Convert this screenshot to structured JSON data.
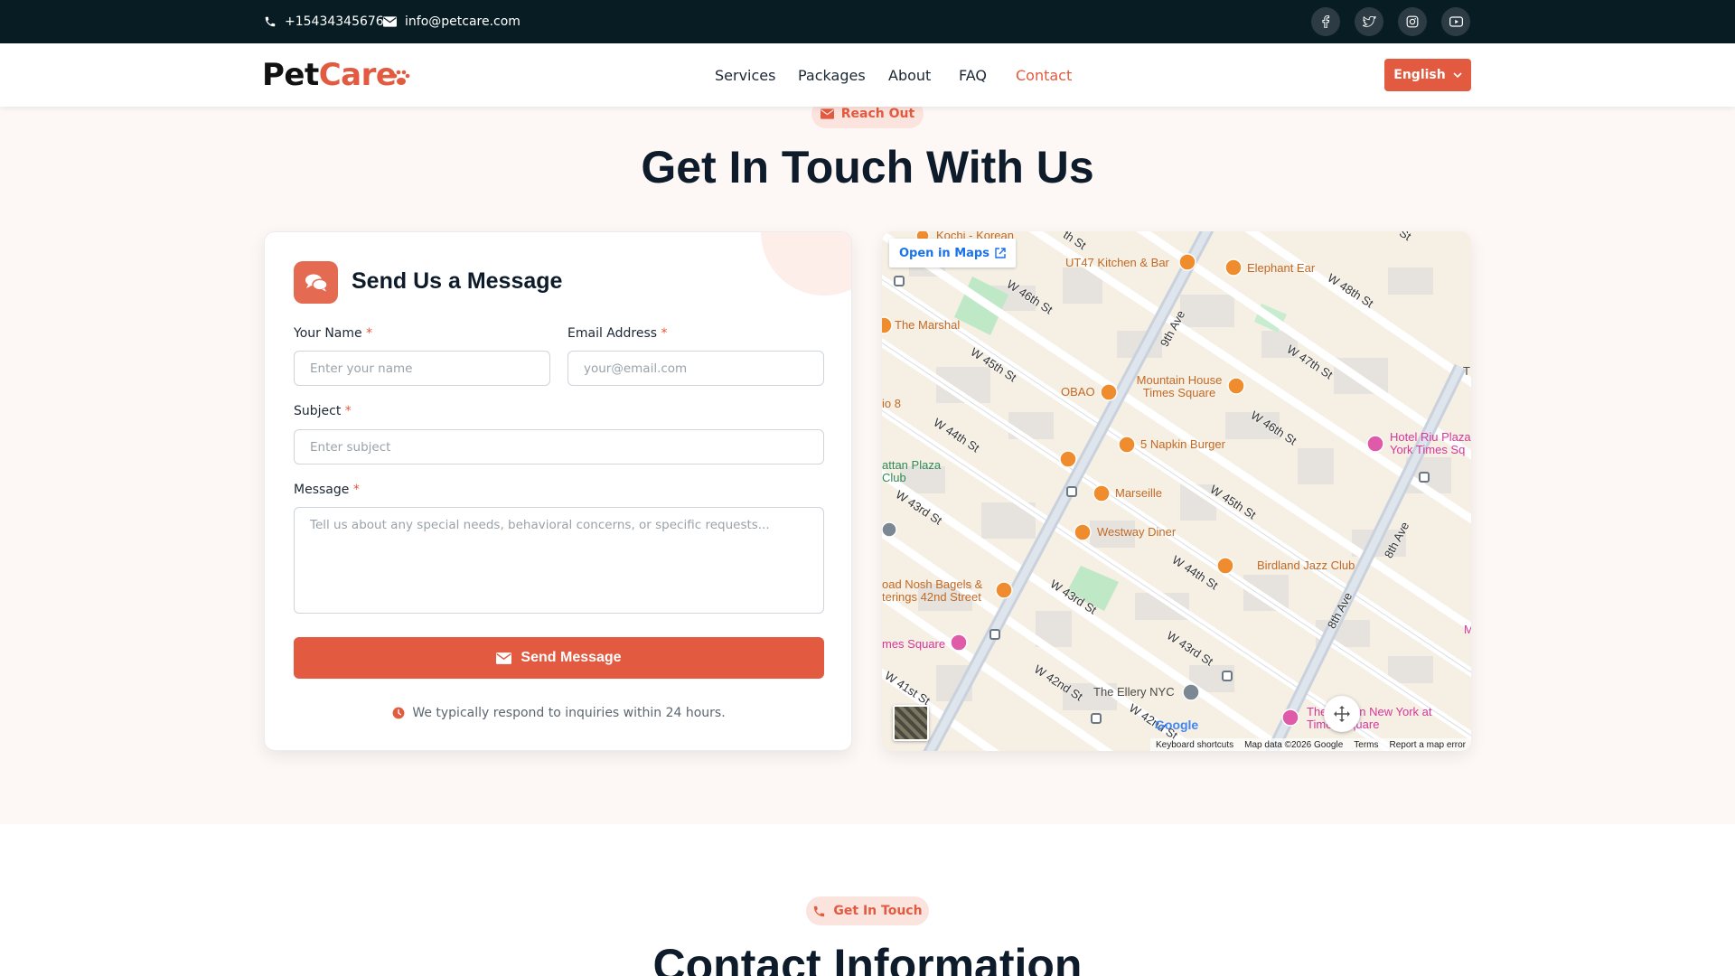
{
  "topbar": {
    "phone": "+15434345676",
    "email": "info@petcare.com",
    "social_icons": [
      "facebook-icon",
      "twitter-icon",
      "instagram-icon",
      "youtube-icon"
    ]
  },
  "nav": {
    "logo_part1": "Pet",
    "logo_part2": "Care",
    "links": [
      "Services",
      "Packages",
      "About",
      "FAQ",
      "Contact"
    ],
    "active": "Contact",
    "language": "English"
  },
  "contact_section": {
    "pill": "Reach Out",
    "title": "Get In Touch With Us"
  },
  "form": {
    "title": "Send Us a Message",
    "name_label": "Your Name",
    "name_placeholder": "Enter your name",
    "email_label": "Email Address",
    "email_placeholder": "your@email.com",
    "subject_label": "Subject",
    "subject_placeholder": "Enter subject",
    "message_label": "Message",
    "message_placeholder": "Tell us about any special needs, behavioral concerns, or specific requests...",
    "required_mark": "*",
    "submit": "Send Message",
    "note": "We typically respond to inquiries within 24 hours."
  },
  "map": {
    "open_maps": "Open in Maps",
    "google": "Google",
    "attribution": [
      "Keyboard shortcuts",
      "Map data ©2026 Google",
      "Terms",
      "Report a map error"
    ],
    "places": {
      "kochi": "Kochi - Korean",
      "ut47": "UT47 Kitchen & Bar",
      "elephant": "Elephant Ear",
      "marshal": "The Marshal",
      "obao": "OBAO",
      "mountain": "Mountain House Times Square",
      "io8": "io 8",
      "napkin": "5 Napkin Burger",
      "riu": "Hotel Riu Plaza York Times Sq",
      "manhattan": "attan Plaza Club",
      "marseille": "Marseille",
      "westway": "Westway Diner",
      "birdland": "Birdland Jazz Club",
      "nosh": "oad Nosh Bagels & terings 42nd Street",
      "times": "mes Square",
      "ellery": "The Ellery NYC",
      "westin": "The Westin New York at Times Square",
      "edge_t": "T",
      "edge_m": "M"
    },
    "streets": [
      "W 46th St",
      "W 45th St",
      "W 44th St",
      "W 43rd St",
      "W 42nd St",
      "W 41st St",
      "W 48th St",
      "W 47th St",
      "W 46th St",
      "W 45th St",
      "W 44th St",
      "W 43rd St",
      "W 43rd St",
      "W 42nd St",
      "9th Ave",
      "8th Ave",
      "8th Ave",
      "th St",
      "St"
    ]
  },
  "info_section": {
    "pill": "Get In Touch",
    "title": "Contact Information"
  },
  "colors": {
    "accent": "#e25a3f",
    "topbar": "#081c24",
    "section_bg": "#fdf8f6",
    "heading": "#0d1b2a"
  }
}
